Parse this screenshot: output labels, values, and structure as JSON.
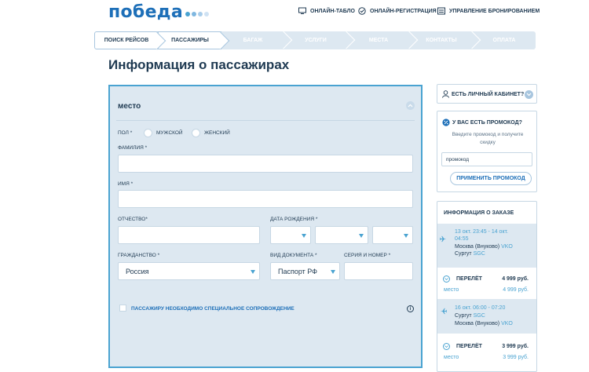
{
  "header": {
    "logo_text": "победа",
    "logo_dot_colors": [
      "#4aa3d1",
      "#7fb7e0",
      "#a9cdea",
      "#cfe2f3"
    ],
    "links": [
      {
        "label": "ОНЛАЙН-ТАБЛО",
        "icon": "monitor-icon"
      },
      {
        "label": "ОНЛАЙН-РЕГИСТРАЦИЯ",
        "icon": "check-circle-icon"
      },
      {
        "label": "УПРАВЛЕНИЕ БРОНИРОВАНИЕМ",
        "icon": "list-icon"
      }
    ]
  },
  "steps": [
    {
      "label": "ПОИСК РЕЙСОВ",
      "state": "done"
    },
    {
      "label": "ПАССАЖИРЫ",
      "state": "active"
    },
    {
      "label": "БАГАЖ",
      "state": "todo"
    },
    {
      "label": "УСЛУГИ",
      "state": "todo"
    },
    {
      "label": "МЕСТА",
      "state": "todo"
    },
    {
      "label": "КОНТАКТЫ",
      "state": "todo"
    },
    {
      "label": "ОПЛАТА",
      "state": "todo"
    }
  ],
  "page_title": "Информация о пассажирах",
  "form": {
    "heading": "место",
    "gender_label": "ПОЛ *",
    "gender_options": [
      "МУЖСКОЙ",
      "ЖЕНСКИЙ"
    ],
    "surname_label": "ФАМИЛИЯ *",
    "name_label": "ИМЯ *",
    "patronymic_label": "ОТЧЕСТВО*",
    "birthdate_label": "ДАТА РОЖДЕНИЯ *",
    "citizenship_label": "ГРАЖДАНСТВО *",
    "citizenship_value": "Россия",
    "doctype_label": "ВИД ДОКУМЕНТА *",
    "doctype_value": "Паспорт РФ",
    "docnum_label": "СЕРИЯ И НОМЕР *",
    "special_label": "ПАССАЖИРУ НЕОБХОДИМО СПЕЦИАЛЬНОЕ СОПРОВОЖДЕНИЕ"
  },
  "sidebar": {
    "account_label": "ЕСТЬ ЛИЧНЫЙ КАБИНЕТ?",
    "promo": {
      "title": "У ВАС ЕСТЬ ПРОМОКОД?",
      "hint_line1": "Введите промокод и получите",
      "hint_line2": "скидку",
      "placeholder": "промокод",
      "button": "ПРИМЕНИТЬ ПРОМОКОД"
    },
    "order": {
      "title": "ИНФОРМАЦИЯ О ЗАКАЗЕ",
      "flights": [
        {
          "time_line1": "13 окт. 23:45 - 14 окт.",
          "time_line2": "04:55",
          "from": "Москва (Внуково)",
          "from_code": "VKO",
          "to": "Сургут",
          "to_code": "SGC",
          "label": "ПЕРЕЛЁТ",
          "price": "4 999 руб.",
          "seat_label": "место",
          "seat_price": "4 999 руб."
        },
        {
          "time_line1": "16 окт. 06:00 - 07:20",
          "from": "Сургут",
          "from_code": "SGC",
          "to": "Москва (Внуково)",
          "to_code": "VKO",
          "label": "ПЕРЕЛЁТ",
          "price": "3 999 руб.",
          "seat_label": "место",
          "seat_price": "3 999 руб."
        }
      ]
    }
  }
}
